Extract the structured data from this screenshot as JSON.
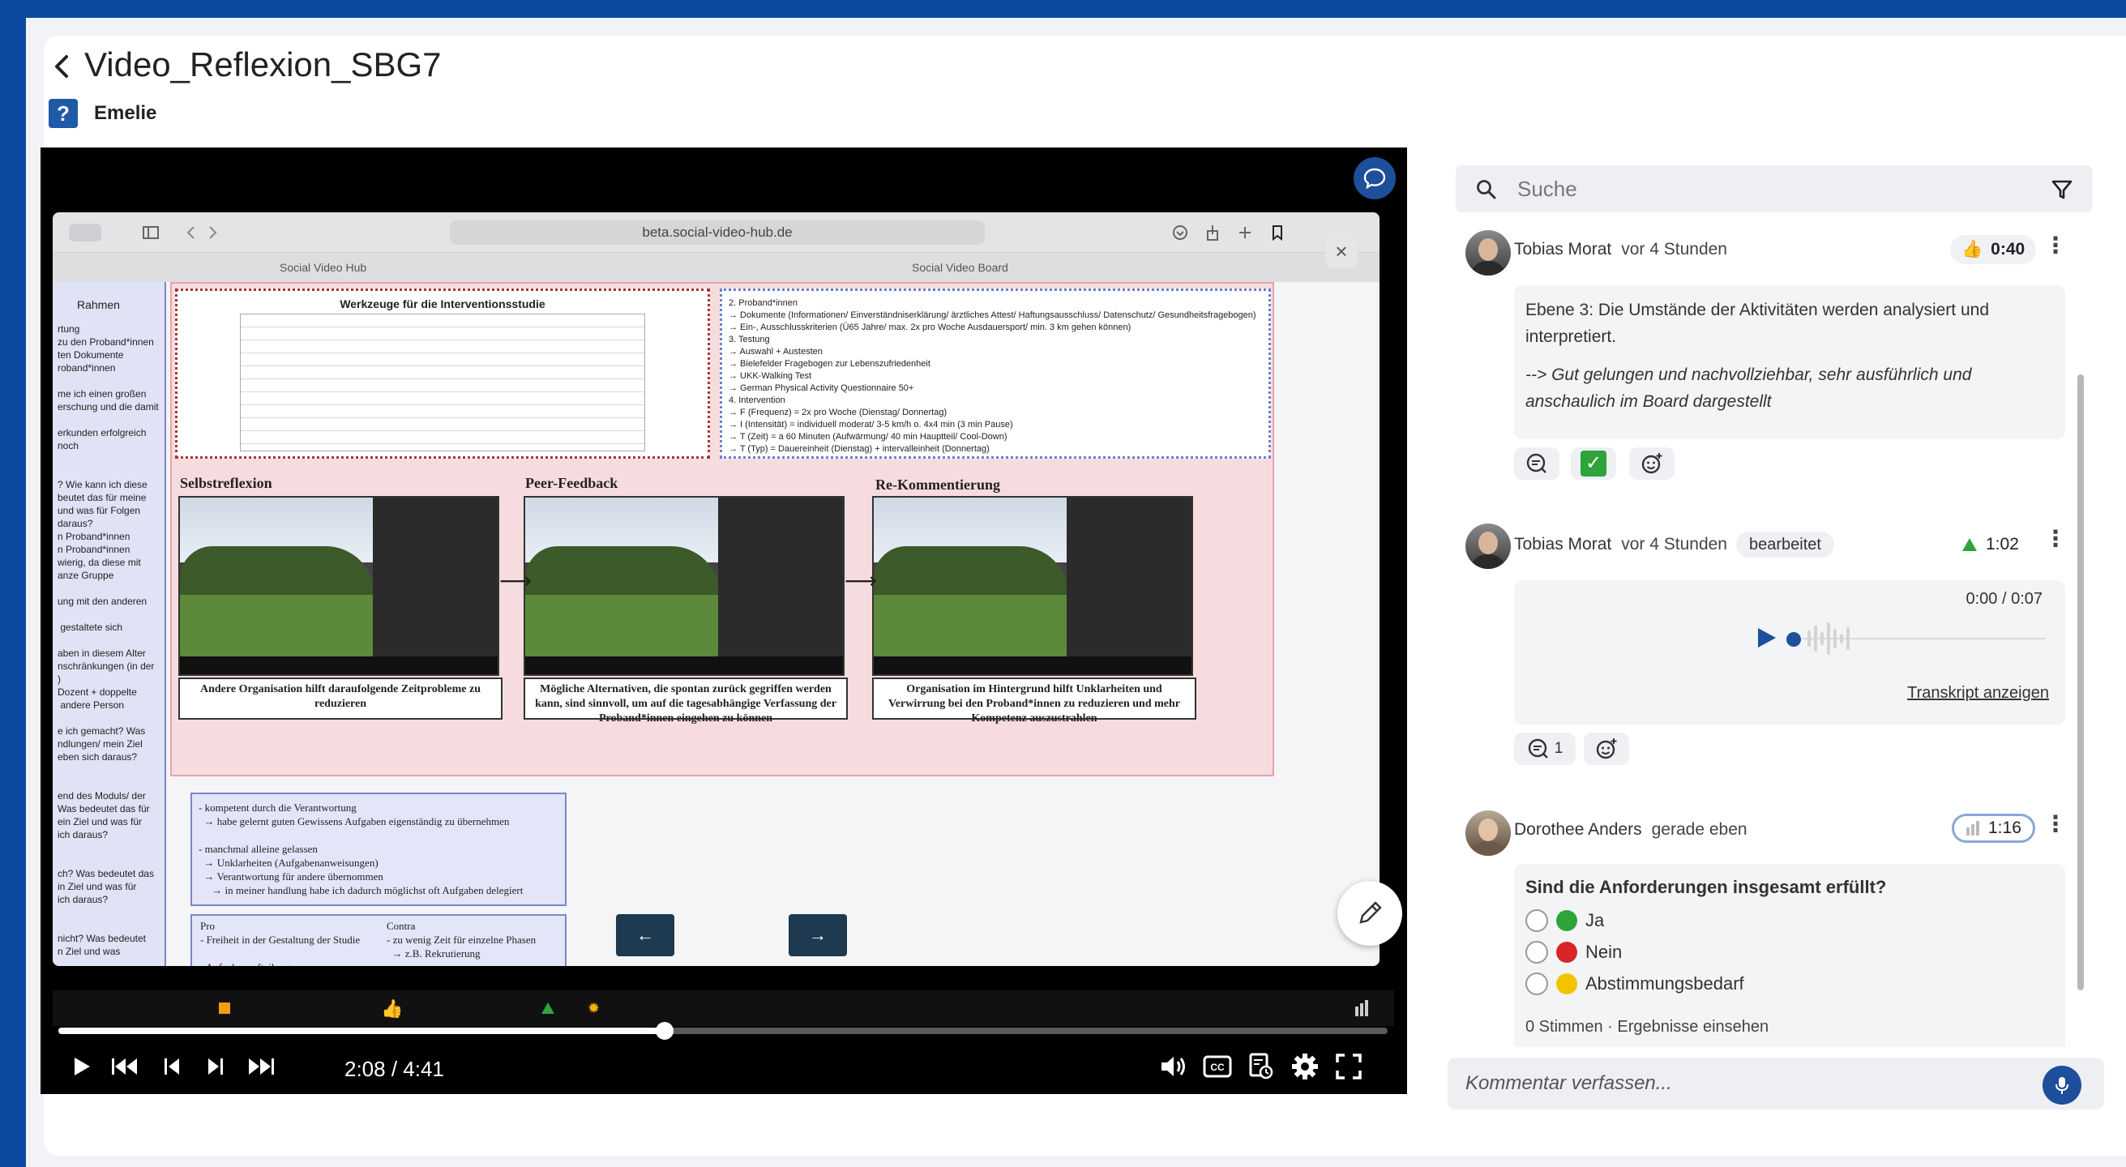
{
  "header": {
    "title": "Video_Reflexion_SBG7",
    "user_badge": "?",
    "user_name": "Emelie"
  },
  "video": {
    "browser": {
      "url": "beta.social-video-hub.de",
      "tab_left": "Social Video Hub",
      "tab_right": "Social Video Board"
    },
    "board": {
      "rahmen": "Rahmen",
      "doc_title": "Werkzeuge für die Interventionsstudie",
      "sections": [
        "Selbstreflexion",
        "Peer-Feedback",
        "Re-Kommentierung"
      ],
      "captions": [
        "Andere Organisation hilft daraufolgende Zeitprobleme zu reduzieren",
        "Mögliche Alternativen, die spontan zurück gegriffen werden kann, sind sinnvoll, um auf die tagesabhängige Verfassung der Proband*innen eingehen zu können",
        "Organisation im Hintergrund hilft Unklarheiten und Verwirrung bei den Proband*innen zu reduzieren und mehr Kompetenz auszustrahlen"
      ],
      "right_doc": "2. Proband*innen\n→ Dokumente (Informationen/ Einverständniserklärung/ ärztliches Attest/ Haftungsausschluss/ Datenschutz/ Gesundheitsfragebogen)\n→ Ein-, Ausschlusskriterien (Ü65 Jahre/ max. 2x pro Woche Ausdauersport/ min. 3 km gehen können)\n3. Testung\n→ Auswahl + Austesten\n→ Bielefelder Fragebogen zur Lebenszufriedenheit\n→ UKK-Walking Test\n→ German Physical Activity Questionnaire 50+\n4. Intervention\n→ F (Frequenz) = 2x pro Woche (Dienstag/ Donnertag)\n→ I (Intensität) = individuell moderat/ 3-5 km/h o. 4x4 min (3 min Pause)\n→ T (Zeit) = a 60 Minuten (Aufwärmung/ 40 min Hauptteil/ Cool-Down)\n→ T (Typ) = Dauereinheit (Dienstag) + intervalleinheit (Donnertag)",
      "left_notes": "rtung\nzu den Proband*innen\nten Dokumente\nroband*innen\n\nme ich einen großen\nerschung und die damit\n\nerkunden erfolgreich\nnoch\n\n\n? Wie kann ich diese\nbeutet das für meine\nund was für Folgen\ndaraus?\nn Proband*innen\nn Proband*innen\nwierig, da diese mit\nanze Gruppe\n\nung mit den anderen\n\n gestaltete sich\n\naben in diesem Alter\nnschränkungen (in der\n)\nDozent + doppelte\n andere Person\n\ne ich gemacht? Was\nndlungen/ mein Ziel\neben sich daraus?\n\n\nend des Moduls/ der\nWas bedeutet das für\nein Ziel und was für\nich daraus?\n\n\nch? Was bedeutet das\nin Ziel und was für\nich daraus?\n\n\nnicht? Was bedeutet\nn Ziel und was",
      "note1": "- kompetent durch die Verantwortung\n  → habe gelernt guten Gewissens Aufgaben eigenständig zu übernehmen\n\n- manchmal alleine gelassen\n  → Unklarheiten (Aufgabenanweisungen)\n  → Verantwortung für andere übernommen\n     → in meiner handlung habe ich dadurch möglichst oft Aufgaben delegiert",
      "note2_pro": "Pro\n- Freiheit in der Gestaltung der Studie\n\n- Aufgabenaufteilung",
      "note2_contra": "Contra\n- zu wenig Zeit für einzelne Phasen\n  → z.B. Rekrutierung\n\n- schwierige Kommunikation untereinander",
      "nav_prev": "←",
      "nav_next": "→"
    },
    "time": "2:08 / 4:41",
    "progress": 0.456
  },
  "search": {
    "placeholder": "Suche"
  },
  "comments": [
    {
      "author": "Tobias Morat",
      "when": "vor 4 Stunden",
      "timestamp": "0:40",
      "marker": "thumbs-up",
      "text": "Ebene 3: Die Umstände der Aktivitäten werden analysiert und interpretiert.",
      "text_italic": "--> Gut gelungen und nachvollziehbar, sehr ausführlich und anschaulich im Board dargestellt"
    },
    {
      "author": "Tobias Morat",
      "when": "vor 4 Stunden",
      "edited": "bearbeitet",
      "timestamp": "1:02",
      "marker": "triangle",
      "audio_time": "0:00 / 0:07",
      "transcript": "Transkript anzeigen",
      "reply_count": "1"
    },
    {
      "author": "Dorothee Anders",
      "when": "gerade eben",
      "timestamp": "1:16",
      "marker": "poll",
      "question": "Sind die Anforderungen insgesamt erfüllt?",
      "options": [
        {
          "label": "Ja",
          "color": "#2ea43a"
        },
        {
          "label": "Nein",
          "color": "#d92525"
        },
        {
          "label": "Abstimmungsbedarf",
          "color": "#f2c300"
        }
      ],
      "footer": "0 Stimmen · Ergebnisse einsehen"
    }
  ],
  "compose": {
    "placeholder": "Kommentar verfassen..."
  },
  "colors": {
    "brand": "#0b4a9e",
    "accent": "#1d4f9a"
  }
}
